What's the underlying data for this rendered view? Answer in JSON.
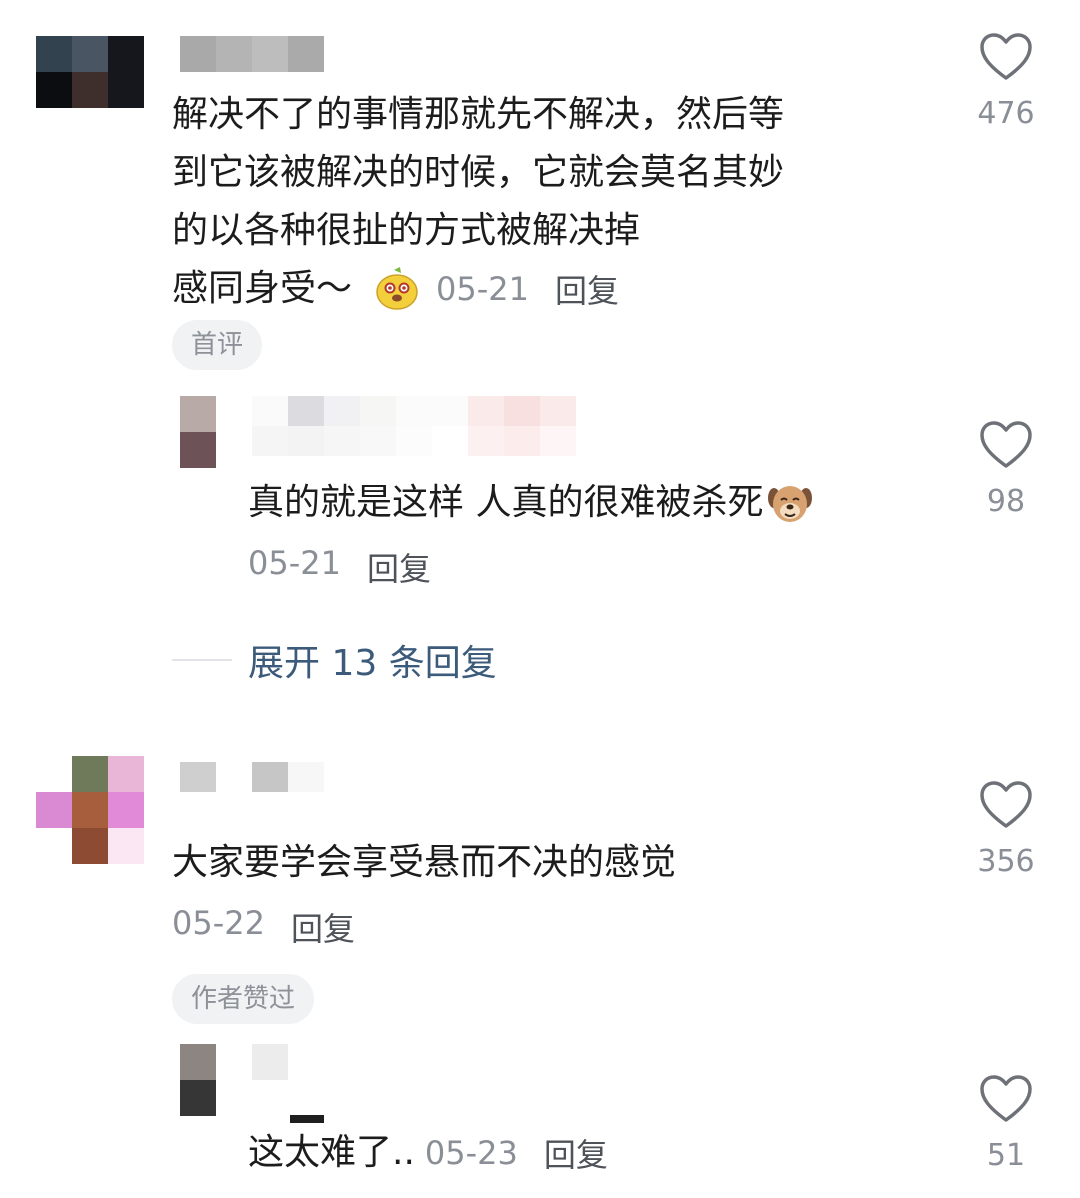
{
  "comments": [
    {
      "text": "解决不了的事情那就先不解决，然后等到它该被解决的时候，它就会莫名其妙的以各种很扯的方式被解决掉",
      "text_lines": [
        "解决不了的事情那就先不解决，然后等",
        "到它该被解决的时候，它就会莫名其妙",
        "的以各种很扯的方式被解决掉"
      ],
      "tail": "感同身受～",
      "tail_emoji_icon": "yellow-mascot-emoji",
      "date": "05-21",
      "reply_label": "回复",
      "badge": "首评",
      "likes": "476",
      "replies": [
        {
          "text": "真的就是这样 人真的很难被杀死",
          "emoji_icon": "dog-face-emoji",
          "date": "05-21",
          "reply_label": "回复",
          "likes": "98"
        }
      ],
      "expand_label": "展开 13 条回复"
    },
    {
      "text": "大家要学会享受悬而不决的感觉",
      "date": "05-22",
      "reply_label": "回复",
      "badge": "作者赞过",
      "likes": "356",
      "replies": [
        {
          "text": "这太难了..",
          "date": "05-23",
          "reply_label": "回复",
          "likes": "51"
        }
      ]
    }
  ],
  "icons": {
    "like": "heart-outline-icon"
  },
  "colors": {
    "text": "#1c1c1c",
    "meta": "#8a8e96",
    "link": "#3c5a7a",
    "badge_bg": "#f1f2f4"
  }
}
